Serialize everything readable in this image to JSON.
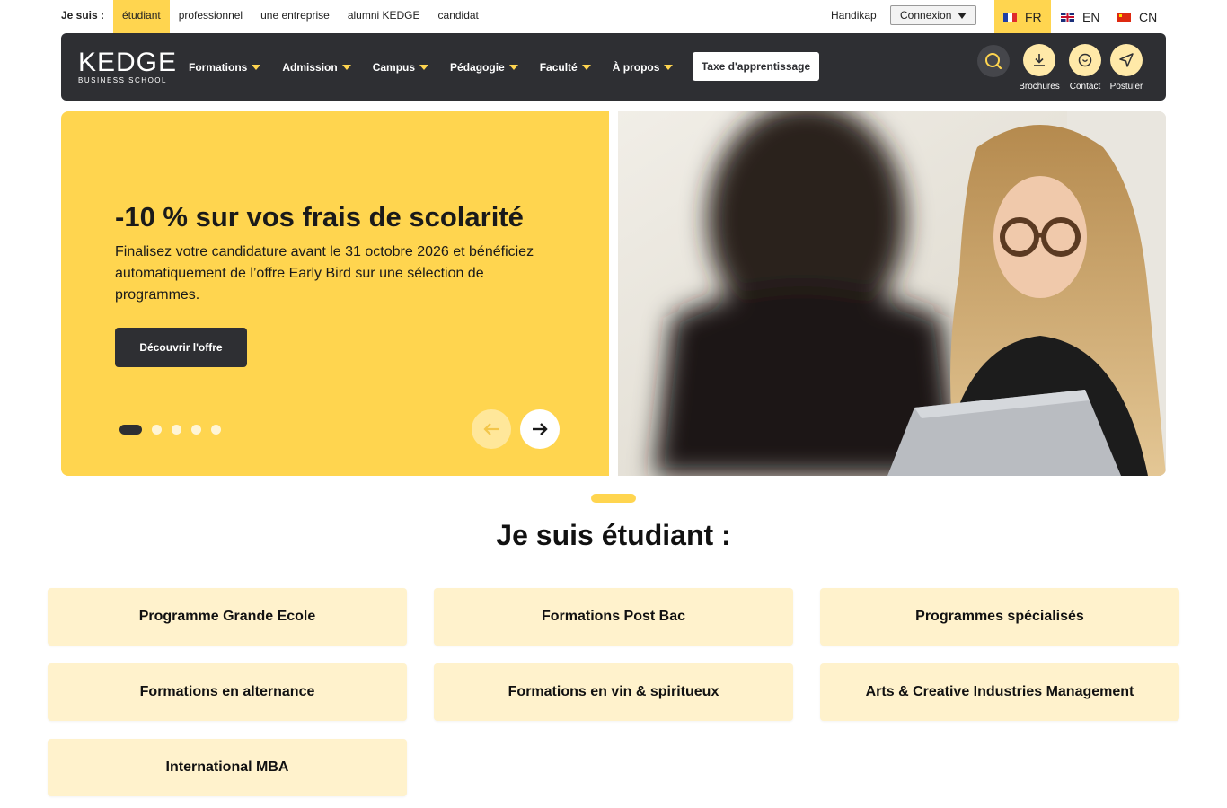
{
  "topbar": {
    "iam_label": "Je suis :",
    "iam_items": [
      {
        "label": "étudiant",
        "active": true
      },
      {
        "label": "professionnel",
        "active": false
      },
      {
        "label": "une entreprise",
        "active": false
      },
      {
        "label": "alumni KEDGE",
        "active": false
      },
      {
        "label": "candidat",
        "active": false
      }
    ],
    "handikap": "Handikap",
    "connexion": "Connexion",
    "languages": [
      {
        "code": "FR",
        "flag": "flag-fr",
        "active": true
      },
      {
        "code": "EN",
        "flag": "flag-en",
        "active": false
      },
      {
        "code": "CN",
        "flag": "flag-cn",
        "active": false
      }
    ]
  },
  "navbar": {
    "logo": {
      "brand": "KEDGE",
      "tagline": "BUSINESS SCHOOL"
    },
    "menu": [
      "Formations",
      "Admission",
      "Campus",
      "Pédagogie",
      "Faculté",
      "À propos"
    ],
    "taxe": "Taxe d'apprentissage",
    "actions": {
      "brochures": "Brochures",
      "contact": "Contact",
      "postuler": "Postuler"
    },
    "icons": {
      "search": "search-icon",
      "brochures": "download-icon",
      "contact": "chat-icon",
      "postuler": "send-icon"
    },
    "colors": {
      "bg": "#2e2f33",
      "accent": "#ffd54f"
    }
  },
  "hero": {
    "title": "-10 % sur vos frais de scolarité",
    "text": "Finalisez votre candidature avant le 31 octobre 2026 et bénéficiez automatiquement de l’offre Early Bird sur une sélection de programmes.",
    "button": "Découvrir l'offre",
    "slide_index": 1,
    "slide_count": 5,
    "bg_color": "#ffd54f"
  },
  "section": {
    "title": "Je suis étudiant :",
    "cards": [
      "Programme Grande Ecole",
      "Formations Post Bac",
      "Programmes spécialisés",
      "Formations en alternance",
      "Formations en vin & spiritueux",
      "Arts & Creative Industries Management",
      "International MBA"
    ]
  }
}
